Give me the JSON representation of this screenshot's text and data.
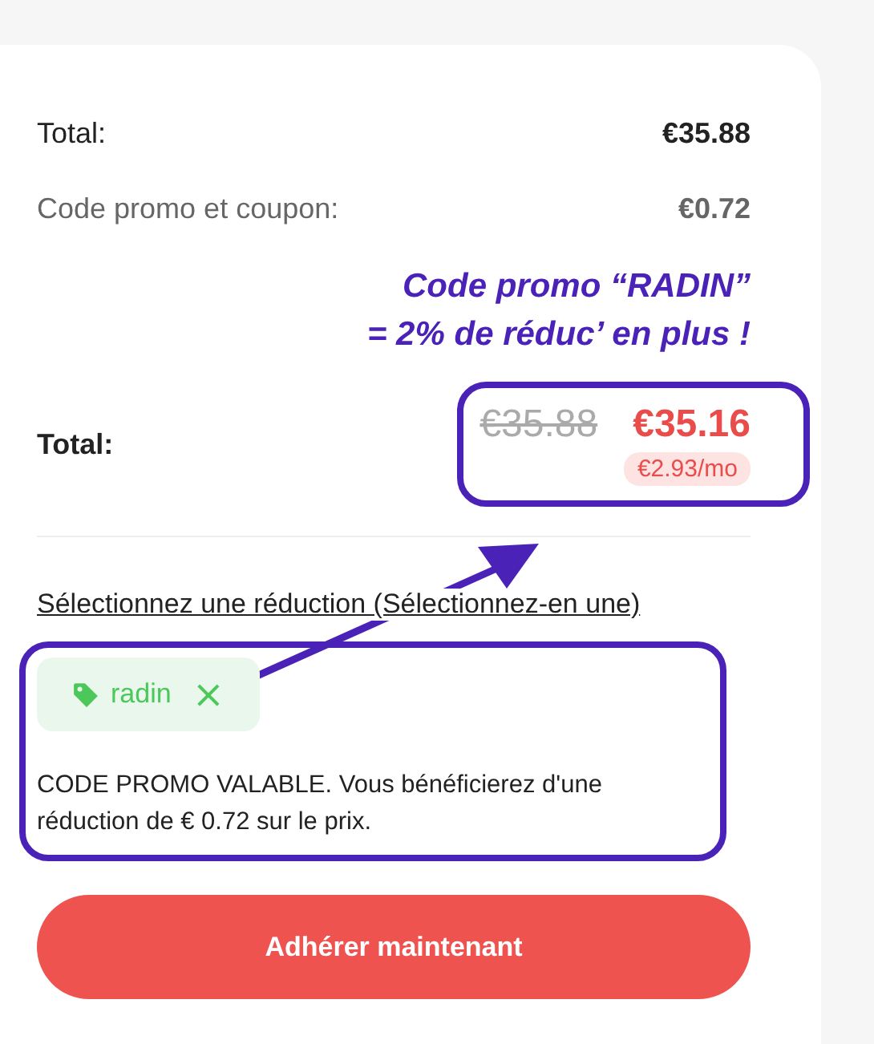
{
  "summary": [
    {
      "label": "Total:",
      "value": "€35.88",
      "kind": "strong"
    },
    {
      "label": "Code promo et coupon:",
      "value": "€0.72",
      "kind": "muted"
    }
  ],
  "callout": {
    "lines": [
      "Code promo “RADIN”",
      "= 2% de réduc’ en plus !"
    ]
  },
  "total": {
    "label": "Total:",
    "old_price": "€35.88",
    "new_price": "€35.16",
    "monthly": "€2.93/mo"
  },
  "discount": {
    "link": "Sélectionnez une réduction (Sélectionnez-en une)",
    "tag": "radin",
    "remove": "×",
    "message": "CODE PROMO VALABLE. Vous bénéficierez d'une réduction de € 0.72 sur le prix."
  },
  "button": "Adhérer maintenant"
}
